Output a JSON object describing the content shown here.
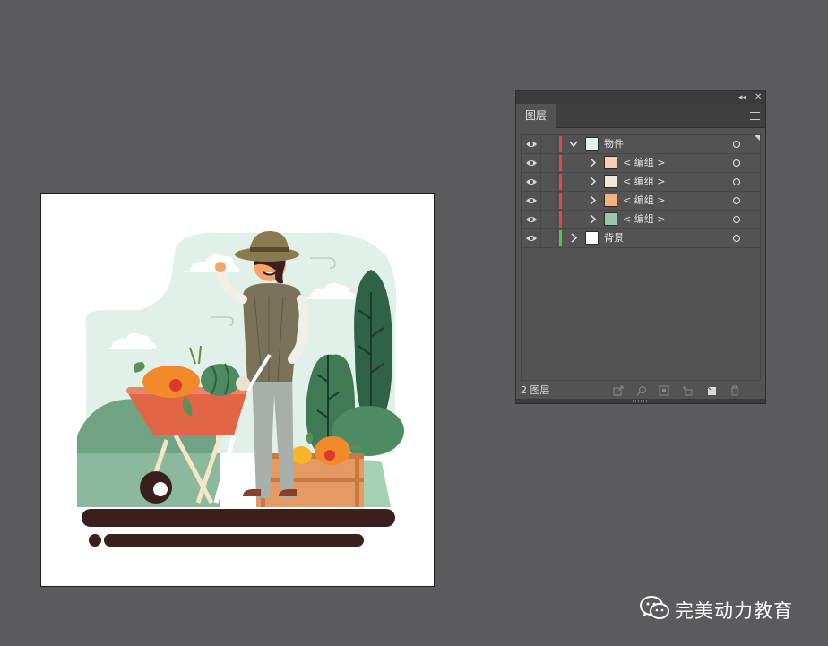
{
  "panel": {
    "tab_label": "图层",
    "collapse_icon": "double-chevron-left-icon",
    "close_icon": "close-icon",
    "menu_icon": "hamburger-menu-icon",
    "layers": [
      {
        "name": "物件",
        "color": "#e0474c",
        "expanded": true,
        "level": 0
      },
      {
        "name": "< 编组 >",
        "color": "#e0474c",
        "expanded": false,
        "level": 1
      },
      {
        "name": "< 编组 >",
        "color": "#e0474c",
        "expanded": false,
        "level": 1
      },
      {
        "name": "< 编组 >",
        "color": "#e0474c",
        "expanded": false,
        "level": 1
      },
      {
        "name": "< 编组 >",
        "color": "#e0474c",
        "expanded": false,
        "level": 1
      },
      {
        "name": "背景",
        "color": "#44d13f",
        "expanded": false,
        "level": 0
      }
    ],
    "footer": {
      "layer_count": "2 图层",
      "icons": [
        "export-icon",
        "search-icon",
        "clipping-mask-icon",
        "new-sublayer-icon",
        "new-layer-icon",
        "trash-icon"
      ]
    }
  },
  "watermark": {
    "text": "完美动力教育",
    "icon": "wechat-icon"
  }
}
